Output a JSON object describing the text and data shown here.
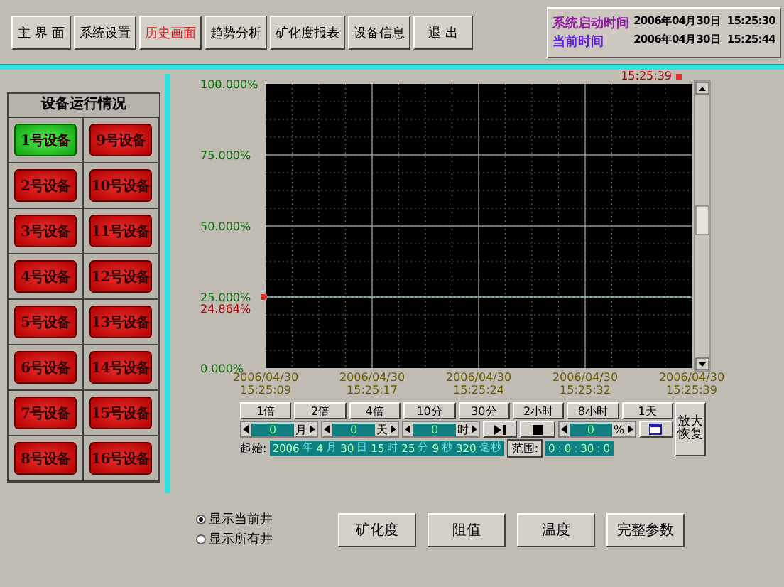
{
  "nav": [
    {
      "label": "主 界 面",
      "selected": false
    },
    {
      "label": "系统设置",
      "selected": false
    },
    {
      "label": "历史画面",
      "selected": true
    },
    {
      "label": "趋势分析",
      "selected": false
    },
    {
      "label": "矿化度报表",
      "selected": false
    },
    {
      "label": "设备信息",
      "selected": false
    },
    {
      "label": "退 出",
      "selected": false
    }
  ],
  "time_panel": {
    "start_label": "系统启动时间",
    "start_value": "2006年04月30日  15:25:30",
    "current_label": "当前时间",
    "current_value": "2006年04月30日  15:25:44"
  },
  "device_panel": {
    "title": "设备运行情况",
    "devices": [
      {
        "label": "1号设备",
        "running": true
      },
      {
        "label": "2号设备",
        "running": false
      },
      {
        "label": "3号设备",
        "running": false
      },
      {
        "label": "4号设备",
        "running": false
      },
      {
        "label": "5号设备",
        "running": false
      },
      {
        "label": "6号设备",
        "running": false
      },
      {
        "label": "7号设备",
        "running": false
      },
      {
        "label": "8号设备",
        "running": false
      },
      {
        "label": "9号设备",
        "running": false
      },
      {
        "label": "10号设备",
        "running": false
      },
      {
        "label": "11号设备",
        "running": false
      },
      {
        "label": "12号设备",
        "running": false
      },
      {
        "label": "13号设备",
        "running": false
      },
      {
        "label": "14号设备",
        "running": false
      },
      {
        "label": "15号设备",
        "running": false
      },
      {
        "label": "16号设备",
        "running": false
      }
    ]
  },
  "chart": {
    "cursor_time": "15:25:39",
    "cursor_value": "24.864%",
    "chart_data": {
      "type": "line",
      "categories": [
        "2006/04/30 15:25:09",
        "2006/04/30 15:25:17",
        "2006/04/30 15:25:24",
        "2006/04/30 15:25:32",
        "2006/04/30 15:25:39"
      ],
      "ylim": [
        0,
        100
      ],
      "yticks": [
        {
          "value": 0,
          "label": "0.000%"
        },
        {
          "value": 25,
          "label": "25.000%"
        },
        {
          "value": 50,
          "label": "50.000%"
        },
        {
          "value": 75,
          "label": "75.000%"
        },
        {
          "value": 100,
          "label": "100.000%"
        }
      ],
      "grid": true,
      "series": [
        {
          "color": "#60c0a0",
          "line_style": "dashed",
          "values": [
            25,
            25,
            25,
            25,
            25
          ]
        }
      ]
    }
  },
  "zoom_buttons": [
    "1倍",
    "2倍",
    "4倍"
  ],
  "range_buttons": [
    "10分",
    "30分",
    "2小时",
    "8小时",
    "1天"
  ],
  "restore_button": "放大恢复",
  "spinners": [
    {
      "value": "0",
      "unit": "月"
    },
    {
      "value": "0",
      "unit": "天"
    },
    {
      "value": "0",
      "unit": "时"
    }
  ],
  "percent_spinner": {
    "value": "0",
    "unit": "%"
  },
  "start": {
    "label": "起始:",
    "fields": [
      {
        "value": "2006",
        "unit": "年"
      },
      {
        "value": "4",
        "unit": "月"
      },
      {
        "value": "30",
        "unit": "日"
      },
      {
        "value": "15",
        "unit": "时"
      },
      {
        "value": "25",
        "unit": "分"
      },
      {
        "value": "9",
        "unit": "秒"
      },
      {
        "value": "320",
        "unit": "毫秒"
      }
    ]
  },
  "range": {
    "label": "范围:",
    "fields": [
      {
        "value": "0",
        "unit": ":"
      },
      {
        "value": "0",
        "unit": ":"
      },
      {
        "value": "30",
        "unit": ":"
      },
      {
        "value": "0"
      }
    ]
  },
  "radios": [
    {
      "label": "显示当前井",
      "selected": true
    },
    {
      "label": "显示所有井",
      "selected": false
    }
  ],
  "bottom_buttons": [
    "矿化度",
    "阻值",
    "温度",
    "完整参数"
  ]
}
